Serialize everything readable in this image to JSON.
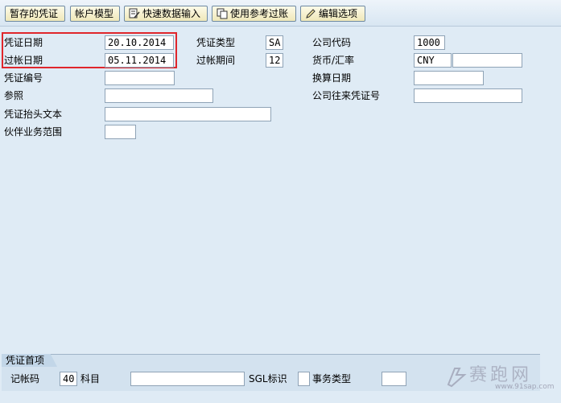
{
  "toolbar": {
    "parked_doc": "暂存的凭证",
    "acct_model": "帐户模型",
    "fast_entry": "快速数据输入",
    "post_ref": "使用参考过账",
    "edit_options": "编辑选项"
  },
  "header": {
    "doc_date_label": "凭证日期",
    "doc_date": "20.10.2014",
    "post_date_label": "过帐日期",
    "post_date": "05.11.2014",
    "doc_type_label": "凭证类型",
    "doc_type": "SA",
    "period_label": "过帐期间",
    "period": "12",
    "company_label": "公司代码",
    "company": "1000",
    "currency_label": "货币/汇率",
    "currency": "CNY",
    "exchange_rate": "",
    "doc_no_label": "凭证编号",
    "doc_no": "",
    "trans_date_label": "换算日期",
    "trans_date": "",
    "ref_label": "参照",
    "ref": "",
    "intercomp_label": "公司往来凭证号",
    "intercomp": "",
    "header_text_label": "凭证抬头文本",
    "header_text": "",
    "partner_ba_label": "伙伴业务范围",
    "partner_ba": ""
  },
  "first_line": {
    "tab": "凭证首项",
    "posting_key_label": "记帐码",
    "posting_key": "40",
    "account_label": "科目",
    "account": "",
    "sgl_label": "SGL标识",
    "sgl": "",
    "trans_type_label": "事务类型",
    "trans_type": ""
  },
  "watermark": {
    "text": "赛跑网",
    "url": "www.91sap.com"
  }
}
